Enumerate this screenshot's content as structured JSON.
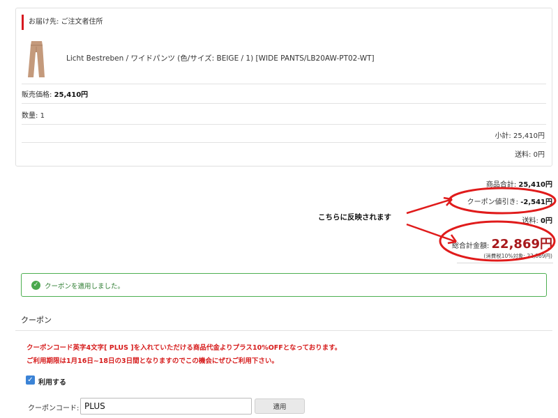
{
  "shipping": {
    "header": "お届け先: ご注文者住所"
  },
  "product": {
    "name": "Licht Bestreben / ワイドパンツ (色/サイズ: BEIGE / 1) [WIDE PANTS/LB20AW-PT02-WT]",
    "price_label": "販売価格: ",
    "price_value": "25,410円",
    "qty_label": "数量: ",
    "qty_value": "1",
    "subtotal_label": "小計: ",
    "subtotal_value": "25,410円",
    "shipping_label": "送料: ",
    "shipping_value": "0円"
  },
  "summary": {
    "items_label": "商品合計: ",
    "items_value": "25,410円",
    "coupon_label": "クーポン値引き: ",
    "coupon_value": "-2,541円",
    "shipping_label": "送料: ",
    "shipping_value": "0円",
    "total_label": "総合計金額: ",
    "total_value": "22,869円",
    "tax_note": "(消費税10%対象: 22,869円)"
  },
  "annotation": {
    "text": "こちらに反映されます",
    "color": "#e01b1b"
  },
  "alert": {
    "text": "クーポンを適用しました。",
    "icon": "check-circle-icon"
  },
  "coupon": {
    "heading": "クーポン",
    "message_line1": "クーポンコード英字4文字[ PLUS ]を入れていただける商品代金よりプラス10%OFFとなっております。",
    "message_line2": "ご利用期限は1月16日~18日の3日間となりますのでこの機会にぜひご利用下さい。",
    "use_label": "利用する",
    "use_checked": true,
    "code_label": "クーポンコード: ",
    "code_value": "PLUS",
    "apply_label": "適用"
  },
  "colors": {
    "accent_red": "#d71920",
    "total_red": "#a8181c",
    "success_green": "#4caf50",
    "checkbox_blue": "#3b83d6"
  }
}
